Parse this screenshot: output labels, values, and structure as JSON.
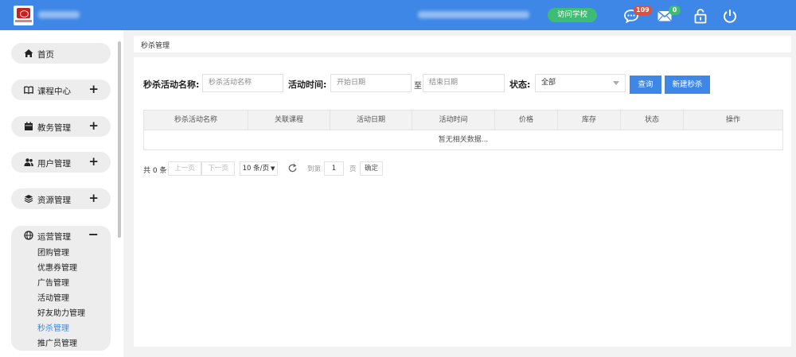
{
  "header": {
    "visit_school_label": "访问学校",
    "messages_count": "109",
    "mail_count": "0",
    "icons": [
      "message-icon",
      "mail-icon",
      "lock-icon",
      "power-icon"
    ]
  },
  "sidebar": {
    "items": [
      {
        "label": "首页",
        "icon": "home-icon"
      },
      {
        "label": "课程中心",
        "icon": "book-icon"
      },
      {
        "label": "教务管理",
        "icon": "calendar-icon"
      },
      {
        "label": "用户管理",
        "icon": "users-icon"
      },
      {
        "label": "资源管理",
        "icon": "box-icon"
      }
    ],
    "operations": {
      "label": "运营管理",
      "icon": "globe-icon",
      "children": [
        "团购管理",
        "优惠券管理",
        "广告管理",
        "活动管理",
        "好友助力管理",
        "秒杀管理",
        "推广员管理"
      ],
      "active": "秒杀管理"
    }
  },
  "breadcrumb": "秒杀管理",
  "filters": {
    "name_label": "秒杀活动名称:",
    "name_placeholder": "秒杀活动名称",
    "time_label": "活动时间:",
    "start_placeholder": "开始日期",
    "to_text": "至",
    "end_placeholder": "结束日期",
    "status_label": "状态:",
    "status_value": "全部",
    "search_button": "查询",
    "new_button": "新建秒杀"
  },
  "table": {
    "columns": [
      "秒杀活动名称",
      "关联课程",
      "活动日期",
      "活动时间",
      "价格",
      "库存",
      "状态",
      "操作"
    ],
    "empty_text": "暂无相关数据..."
  },
  "pagination": {
    "total": "共 0 条",
    "prev": "上一页",
    "next": "下一页",
    "page_size": "10 条/页",
    "goto_prefix": "到第",
    "goto_value": "1",
    "goto_suffix": "页",
    "confirm": "确定"
  },
  "colors": {
    "primary": "#3e87e6",
    "success": "#3dbd74",
    "danger": "#e44c3c"
  }
}
